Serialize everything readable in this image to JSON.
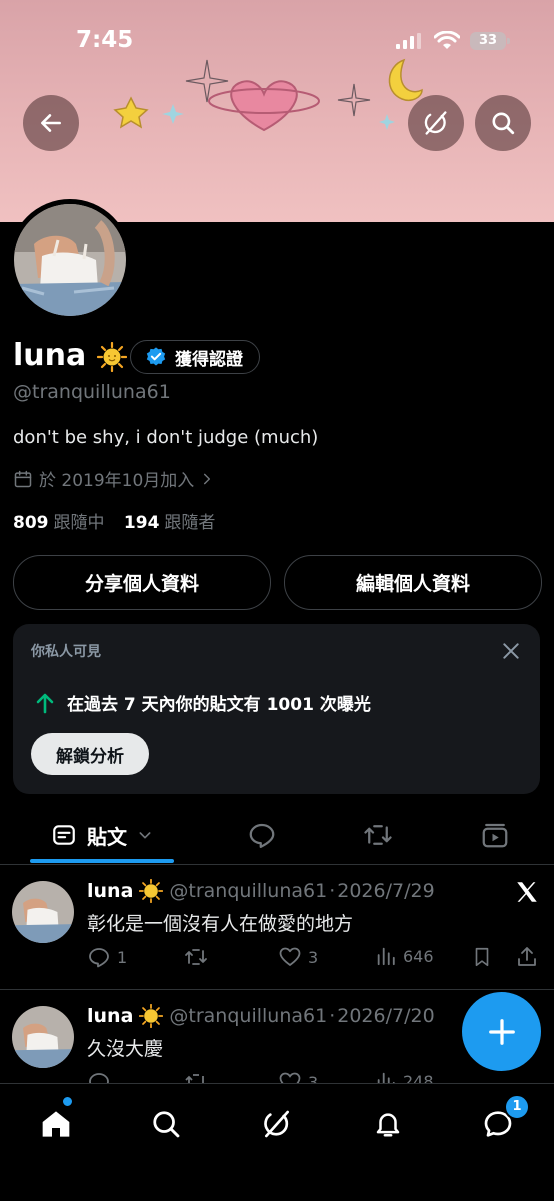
{
  "status_bar": {
    "time": "7:45",
    "battery": "33"
  },
  "profile": {
    "name": "luna",
    "verified_label": "獲得認證",
    "handle": "@tranquilluna61",
    "bio": "don't be shy, i don't judge (much)",
    "joined": "於 2019年10月加入",
    "following_count": "809",
    "following_label": "跟隨中",
    "followers_count": "194",
    "followers_label": "跟隨者"
  },
  "buttons": {
    "share": "分享個人資料",
    "edit": "編輯個人資料"
  },
  "private_card": {
    "label": "你私人可見",
    "stat_text": "在過去 7 天內你的貼文有 1001 次曝光",
    "unlock_label": "解鎖分析"
  },
  "tabs": {
    "posts_label": "貼文"
  },
  "posts": [
    {
      "name": "luna",
      "handle": "@tranquilluna61",
      "date": "2026/7/29",
      "text": "彰化是一個沒有人在做愛的地方",
      "replies": "1",
      "likes": "3",
      "views": "646"
    },
    {
      "name": "luna",
      "handle": "@tranquilluna61",
      "date": "2026/7/20",
      "text": "久沒大慶",
      "replies": "",
      "likes": "3",
      "views": "248"
    }
  ],
  "nav": {
    "messages_badge": "1"
  },
  "colors": {
    "accent": "#1d9bf0",
    "banner": "#e7b4b6",
    "background": "#000000",
    "muted": "#71767b"
  }
}
